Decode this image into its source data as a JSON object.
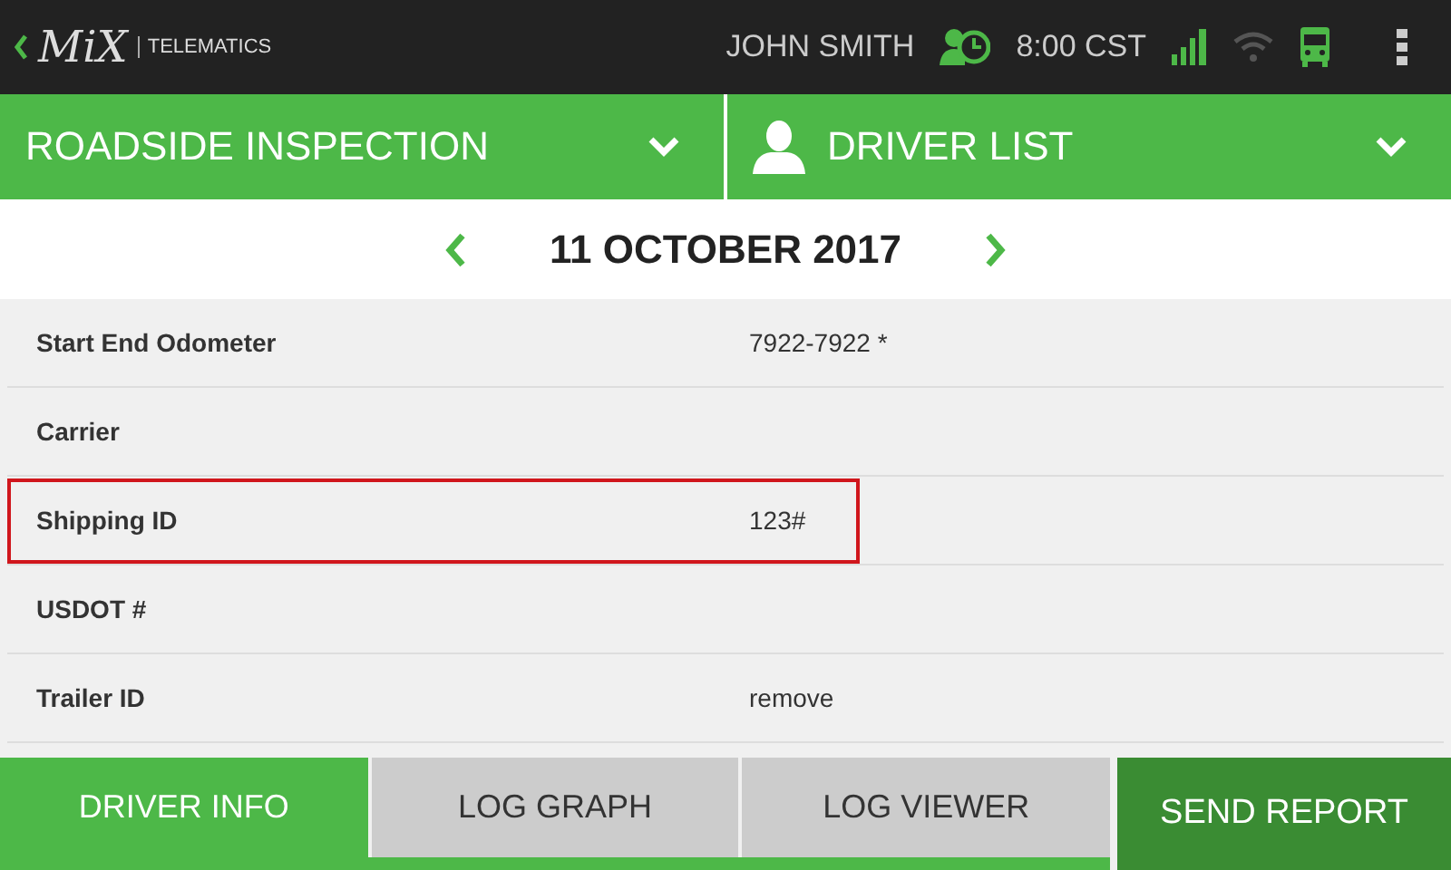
{
  "top_bar": {
    "logo": "MiX",
    "brand": "TELEMATICS",
    "driver": "JOHN SMITH",
    "time": "8:00 CST"
  },
  "header": {
    "left": "ROADSIDE INSPECTION",
    "right": "DRIVER LIST"
  },
  "date": "11 OCTOBER 2017",
  "rows": [
    {
      "label": "Start End Odometer",
      "value": "7922-7922 *",
      "highlighted": false
    },
    {
      "label": "Carrier",
      "highlighted": false
    },
    {
      "label": "Shipping ID",
      "value": "123#",
      "highlighted": true
    },
    {
      "label": "USDOT #",
      "highlighted": false
    },
    {
      "label": "Trailer ID",
      "value": "remove",
      "highlighted": false
    }
  ],
  "tabs": [
    {
      "label": "DRIVER INFO",
      "selected": true
    },
    {
      "label": "LOG GRAPH",
      "selected": false
    },
    {
      "label": "LOG VIEWER",
      "selected": false
    }
  ],
  "send_button": "SEND REPORT"
}
